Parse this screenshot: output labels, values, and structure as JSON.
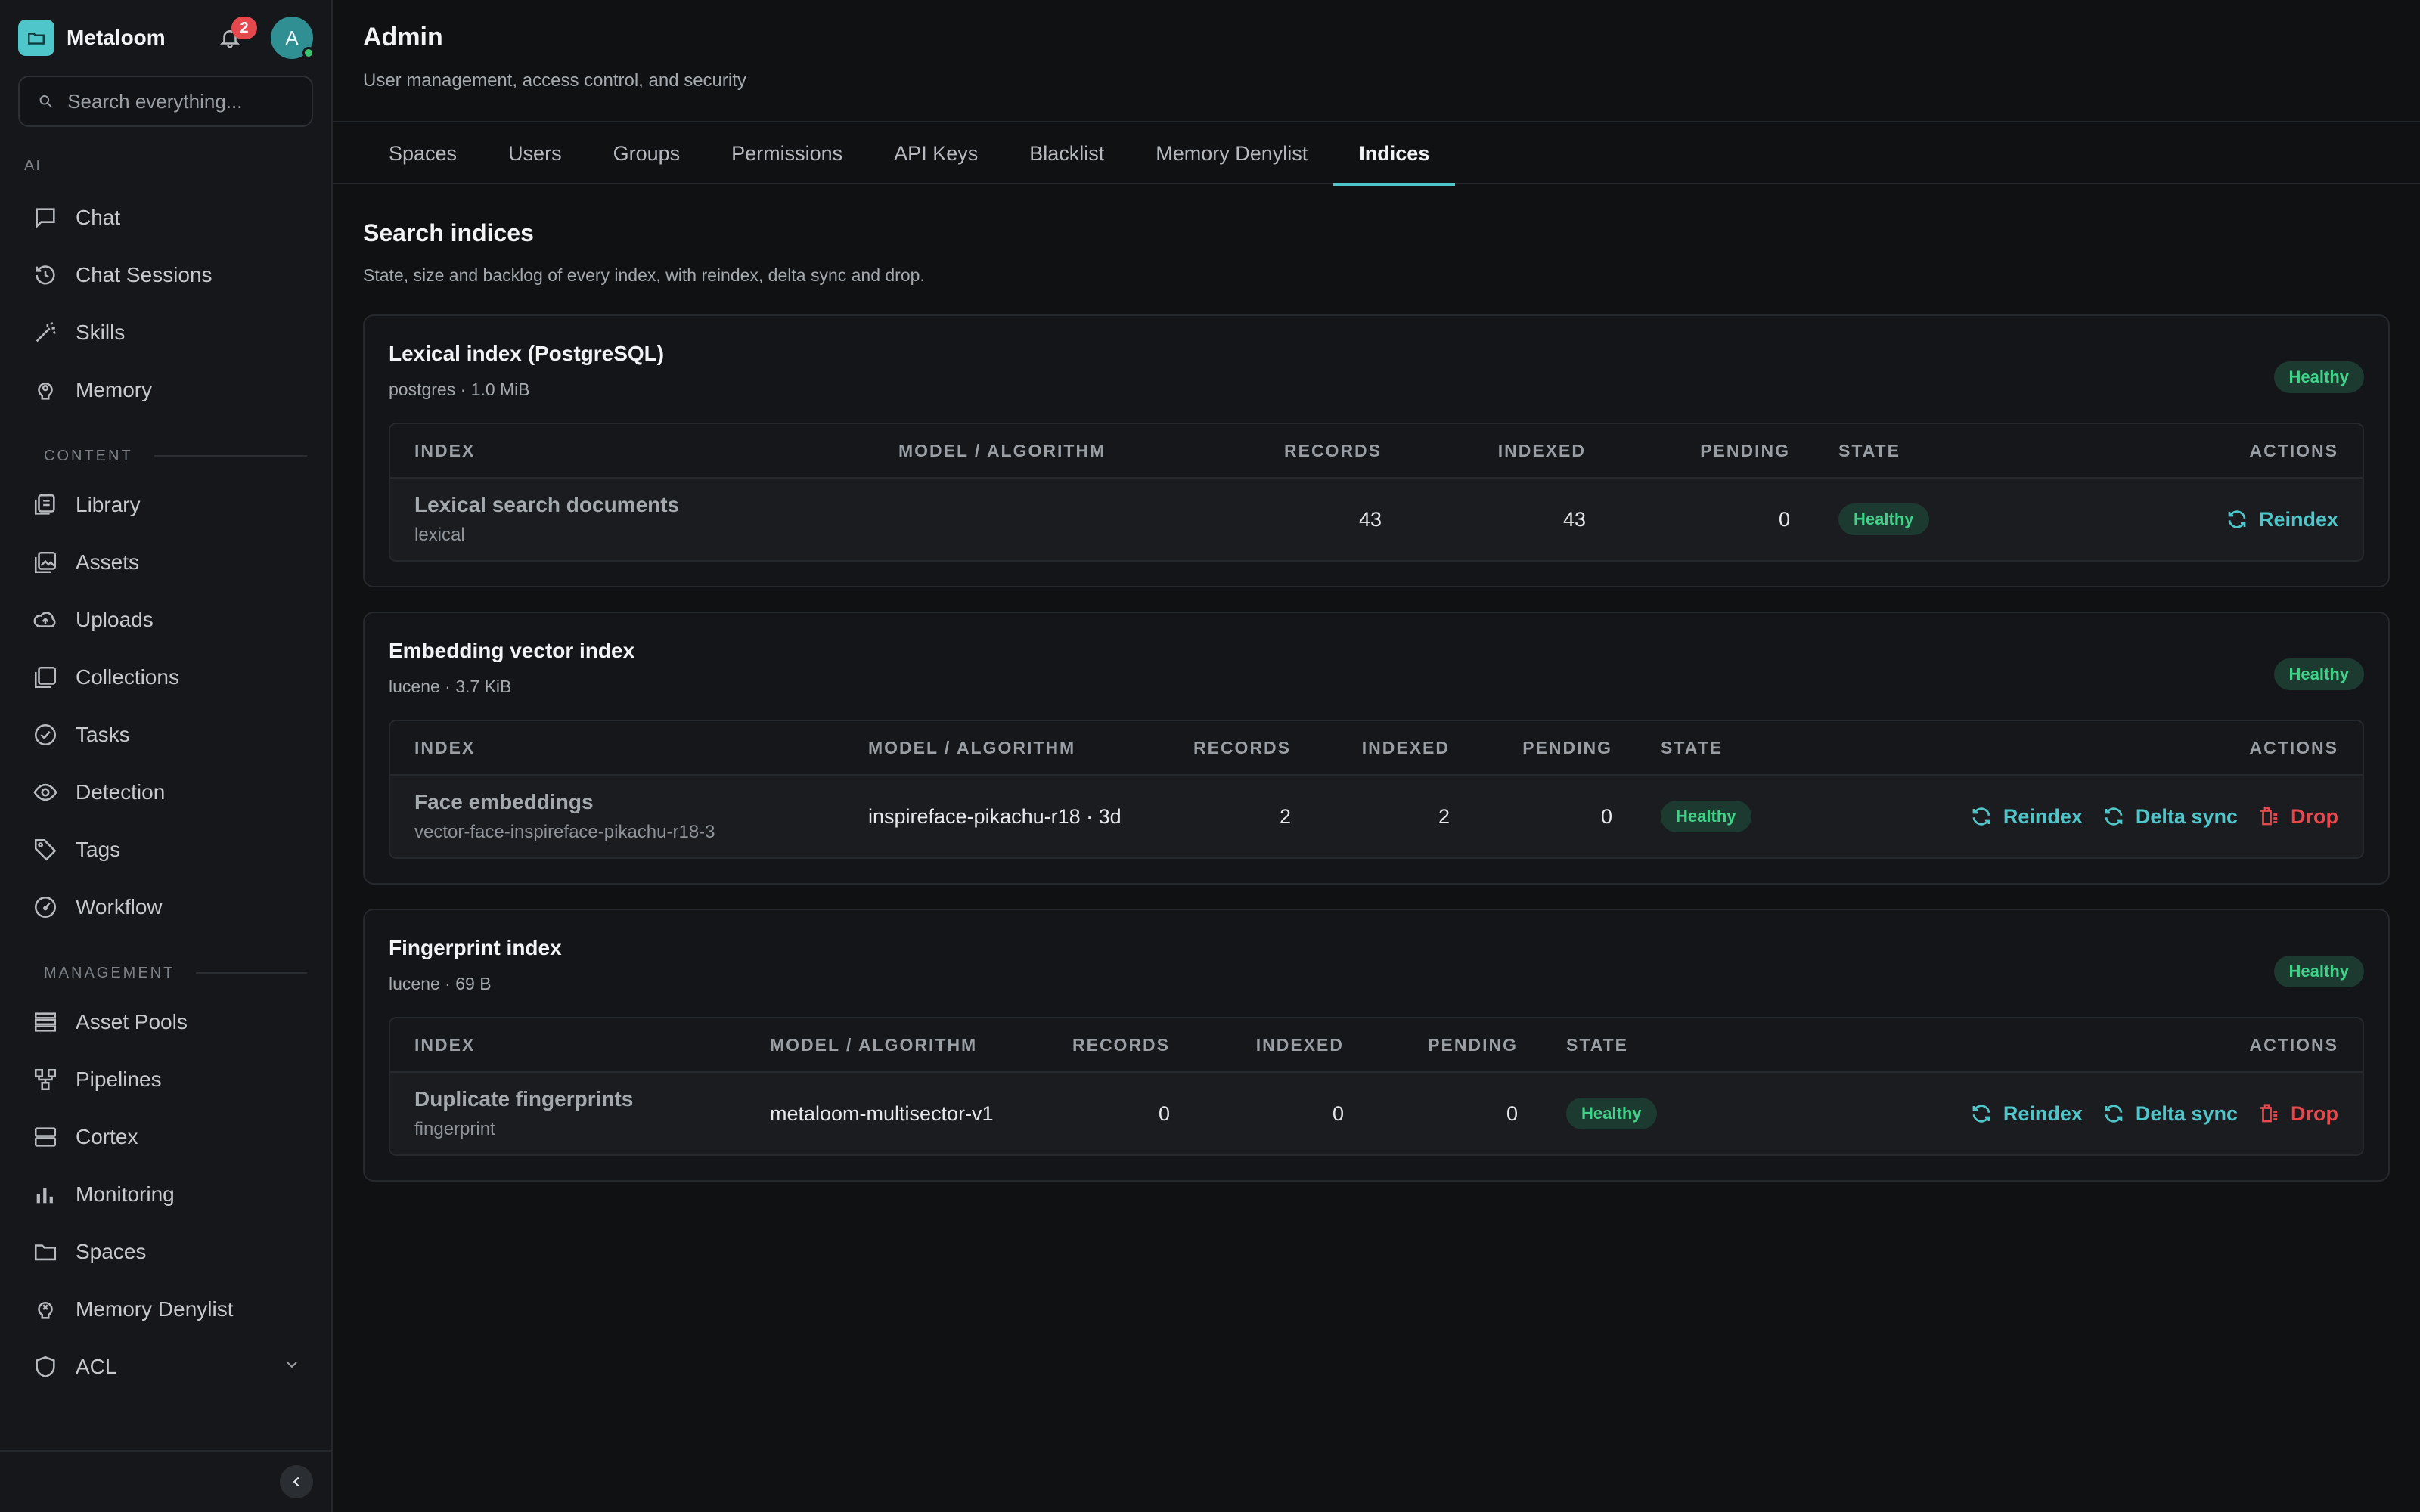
{
  "app": {
    "name": "Metaloom",
    "notifications": "2",
    "avatar_initial": "A"
  },
  "search": {
    "placeholder": "Search everything..."
  },
  "sidebar": {
    "sections": {
      "ai": "AI",
      "content": "CONTENT",
      "management": "MANAGEMENT"
    },
    "ai_items": [
      {
        "label": "Chat",
        "icon": "chat-bubble-icon"
      },
      {
        "label": "Chat Sessions",
        "icon": "history-icon"
      },
      {
        "label": "Skills",
        "icon": "magic-wand-icon"
      },
      {
        "label": "Memory",
        "icon": "brain-icon"
      }
    ],
    "content_items": [
      {
        "label": "Library",
        "icon": "library-icon"
      },
      {
        "label": "Assets",
        "icon": "images-icon"
      },
      {
        "label": "Uploads",
        "icon": "cloud-upload-icon"
      },
      {
        "label": "Collections",
        "icon": "collections-icon"
      },
      {
        "label": "Tasks",
        "icon": "check-circle-icon"
      },
      {
        "label": "Detection",
        "icon": "eye-icon"
      },
      {
        "label": "Tags",
        "icon": "tag-icon"
      },
      {
        "label": "Workflow",
        "icon": "gauge-icon"
      }
    ],
    "management_items": [
      {
        "label": "Asset Pools",
        "icon": "stack-icon"
      },
      {
        "label": "Pipelines",
        "icon": "pipeline-icon"
      },
      {
        "label": "Cortex",
        "icon": "server-icon"
      },
      {
        "label": "Monitoring",
        "icon": "bar-chart-icon"
      },
      {
        "label": "Spaces",
        "icon": "folder-icon"
      },
      {
        "label": "Memory Denylist",
        "icon": "brain-off-icon"
      },
      {
        "label": "ACL",
        "icon": "shield-icon"
      }
    ]
  },
  "page": {
    "title": "Admin",
    "subtitle": "User management, access control, and security",
    "tabs": [
      "Spaces",
      "Users",
      "Groups",
      "Permissions",
      "API Keys",
      "Blacklist",
      "Memory Denylist",
      "Indices"
    ],
    "active_tab": "Indices"
  },
  "indices": {
    "title": "Search indices",
    "subtitle": "State, size and backlog of every index, with reindex, delta sync and drop.",
    "columns": {
      "index": "INDEX",
      "model": "MODEL / ALGORITHM",
      "records": "RECORDS",
      "indexed": "INDEXED",
      "pending": "PENDING",
      "state": "STATE",
      "actions": "ACTIONS"
    },
    "actions": {
      "reindex": "Reindex",
      "delta_sync": "Delta sync",
      "drop": "Drop"
    },
    "cards": [
      {
        "title": "Lexical index (PostgreSQL)",
        "meta": "postgres · 1.0 MiB",
        "status": "Healthy",
        "row": {
          "name": "Lexical search documents",
          "key": "lexical",
          "model": "",
          "records": "43",
          "indexed": "43",
          "pending": "0",
          "state": "Healthy"
        }
      },
      {
        "title": "Embedding vector index",
        "meta": "lucene · 3.7 KiB",
        "status": "Healthy",
        "row": {
          "name": "Face embeddings",
          "key": "vector-face-inspireface-pikachu-r18-3",
          "model": "inspireface-pikachu-r18 · 3d",
          "records": "2",
          "indexed": "2",
          "pending": "0",
          "state": "Healthy"
        }
      },
      {
        "title": "Fingerprint index",
        "meta": "lucene · 69 B",
        "status": "Healthy",
        "row": {
          "name": "Duplicate fingerprints",
          "key": "fingerprint",
          "model": "metaloom-multisector-v1",
          "records": "0",
          "indexed": "0",
          "pending": "0",
          "state": "Healthy"
        }
      }
    ]
  },
  "colors": {
    "accent": "#4fc6c9",
    "healthy": "#3fd38a",
    "danger": "#e5484d",
    "background": "#0f1113"
  }
}
